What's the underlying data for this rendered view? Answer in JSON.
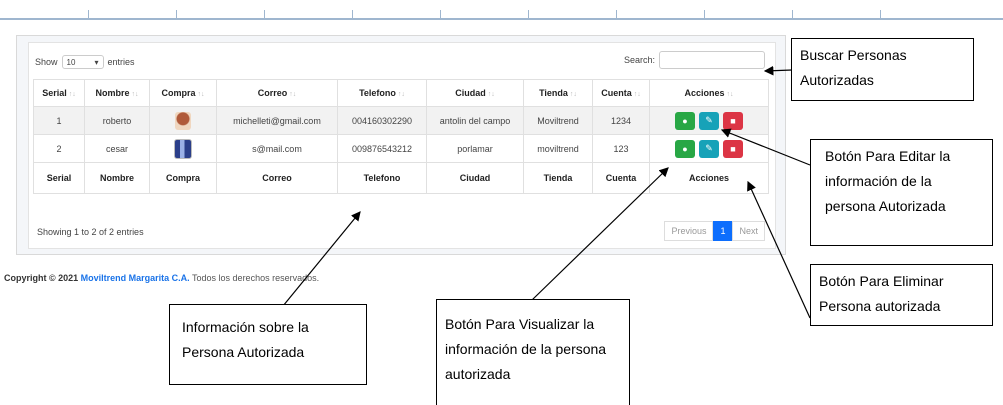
{
  "table": {
    "show_label": "Show",
    "entries_value": "10",
    "entries_label": "entries",
    "search_label": "Search:",
    "columns": [
      "Serial",
      "Nombre",
      "Compra",
      "Correo",
      "Telefono",
      "Ciudad",
      "Tienda",
      "Cuenta",
      "Acciones"
    ],
    "rows": [
      {
        "serial": "1",
        "nombre": "roberto",
        "correo": "michelleti@gmail.com",
        "telefono": "004160302290",
        "ciudad": "antolin del campo",
        "tienda": "Moviltrend",
        "cuenta": "1234"
      },
      {
        "serial": "2",
        "nombre": "cesar",
        "correo": "s@mail.com",
        "telefono": "009876543212",
        "ciudad": "porlamar",
        "tienda": "moviltrend",
        "cuenta": "123"
      }
    ],
    "info": "Showing 1 to 2 of 2 entries",
    "pagination": {
      "previous": "Previous",
      "page": "1",
      "next": "Next"
    }
  },
  "footer": {
    "copyright": "Copyright © 2021",
    "brand": "Moviltrend Margarita C.A.",
    "rights": "Todos los derechos reservados."
  },
  "callouts": {
    "buscar": "Buscar Personas Autorizadas",
    "editar": "Botón Para Editar la información de la persona Autorizada",
    "eliminar": "Botón Para Eliminar Persona autorizada",
    "informacion": "Información sobre la Persona Autorizada",
    "visualizar": "Botón Para Visualizar la información de la persona autorizada"
  },
  "icons": {
    "view": "eye-icon",
    "edit": "edit-icon",
    "delete": "trash-icon"
  },
  "colors": {
    "view": "#28a745",
    "edit": "#17a2b8",
    "delete": "#dc3545",
    "active_page": "#0d6efd",
    "brand": "#1a73e8"
  }
}
